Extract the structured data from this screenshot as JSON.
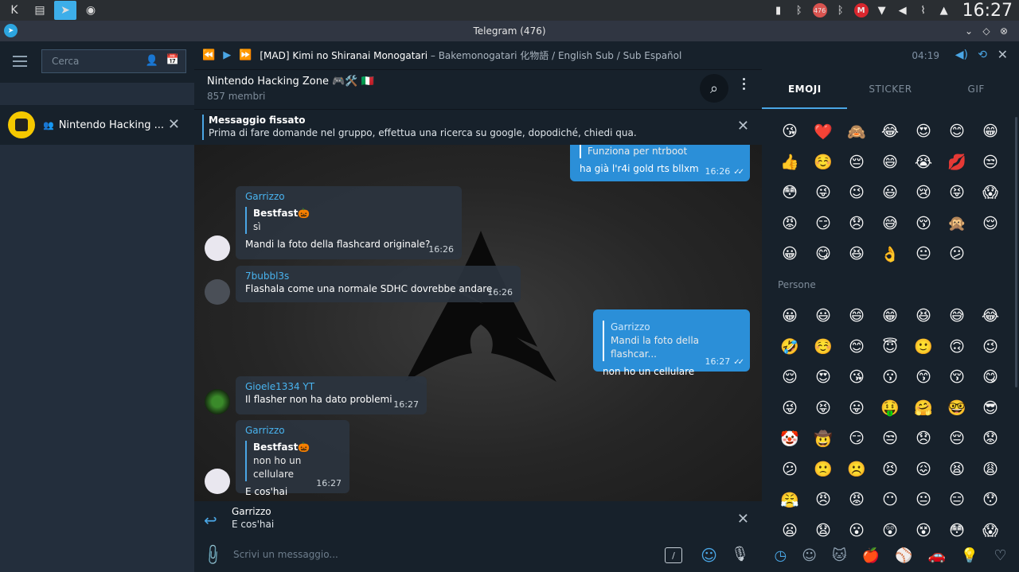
{
  "system_panel": {
    "clock": "16:27",
    "tray_badge": "476"
  },
  "window": {
    "title": "Telegram (476)"
  },
  "sidebar": {
    "search_placeholder": "Cerca",
    "chat_item": {
      "name": "Nintendo Hacking ...",
      "avatar_color": "#f5c800"
    }
  },
  "player": {
    "title_bold": "[MAD] Kimi no Shiranai Monogatari",
    "title_rest": " – Bakemonogatari 化物語 / English Sub / Sub Español",
    "time": "04:19"
  },
  "chat": {
    "title": "Nintendo Hacking Zone 🎮🛠️ 🇮🇹",
    "members": "857 membri"
  },
  "pinned": {
    "label": "Messaggio fissato",
    "text": "Prima di fare domande nel gruppo, effettua una ricerca su google, dopodiché, chiedi qua."
  },
  "messages": [
    {
      "reply_text": "Funziona per ntrboot",
      "text": "ha già l'r4i gold rts bllxm",
      "time": "16:26"
    },
    {
      "sender": "Garrizzo",
      "reply_name": "Bestfast🎃",
      "reply_text": "sì",
      "text": "Mandi la foto della flashcard originale?",
      "time": "16:26"
    },
    {
      "sender": "7bubbl3s",
      "text": "Flashala come una normale SDHC dovrebbe andare",
      "time": "16:26"
    },
    {
      "reply_name": "Garrizzo",
      "reply_text": "Mandi la foto della flashcar...",
      "text": "non ho un cellulare",
      "time": "16:27"
    },
    {
      "sender": "Gioele1334 YT",
      "text": "Il flasher non ha dato problemi",
      "time": "16:27"
    },
    {
      "sender": "Garrizzo",
      "reply_name": "Bestfast🎃",
      "reply_text": "non ho un cellulare",
      "text": "E cos'hai",
      "time": "16:27"
    }
  ],
  "reply_bar": {
    "name": "Garrizzo",
    "text": "E cos'hai"
  },
  "input": {
    "placeholder": "Scrivi un messaggio..."
  },
  "emoji_panel": {
    "tabs": [
      "EMOJI",
      "STICKER",
      "GIF"
    ],
    "recent": [
      "😘",
      "❤️",
      "🙈",
      "😂",
      "😍",
      "😊",
      "😁",
      "👍",
      "☺️",
      "😔",
      "😄",
      "😭",
      "💋",
      "😒",
      "😳",
      "😜",
      "😉",
      "😃",
      "😢",
      "😝",
      "😱",
      "😡",
      "😏",
      "😞",
      "😅",
      "😚",
      "🙊",
      "😌",
      "😀",
      "😋",
      "😆",
      "👌",
      "😐",
      "😕"
    ],
    "section_label": "Persone",
    "people": [
      "😀",
      "😃",
      "😄",
      "😁",
      "😆",
      "😅",
      "😂",
      "🤣",
      "☺️",
      "😊",
      "😇",
      "🙂",
      "🙃",
      "😉",
      "😌",
      "😍",
      "😘",
      "😗",
      "😙",
      "😚",
      "😋",
      "😜",
      "😝",
      "😛",
      "🤑",
      "🤗",
      "🤓",
      "😎",
      "🤡",
      "🤠",
      "😏",
      "😒",
      "😞",
      "😔",
      "😟",
      "😕",
      "🙁",
      "☹️",
      "😣",
      "😖",
      "😫",
      "😩",
      "😤",
      "😠",
      "😡",
      "😶",
      "😐",
      "😑",
      "😯",
      "😦",
      "😧",
      "😮",
      "😲",
      "😵",
      "😳",
      "😱"
    ],
    "categories": [
      "recent-icon",
      "smile-icon",
      "cat-icon",
      "apple-icon",
      "ball-icon",
      "car-icon",
      "bulb-icon",
      "heart-icon"
    ]
  }
}
